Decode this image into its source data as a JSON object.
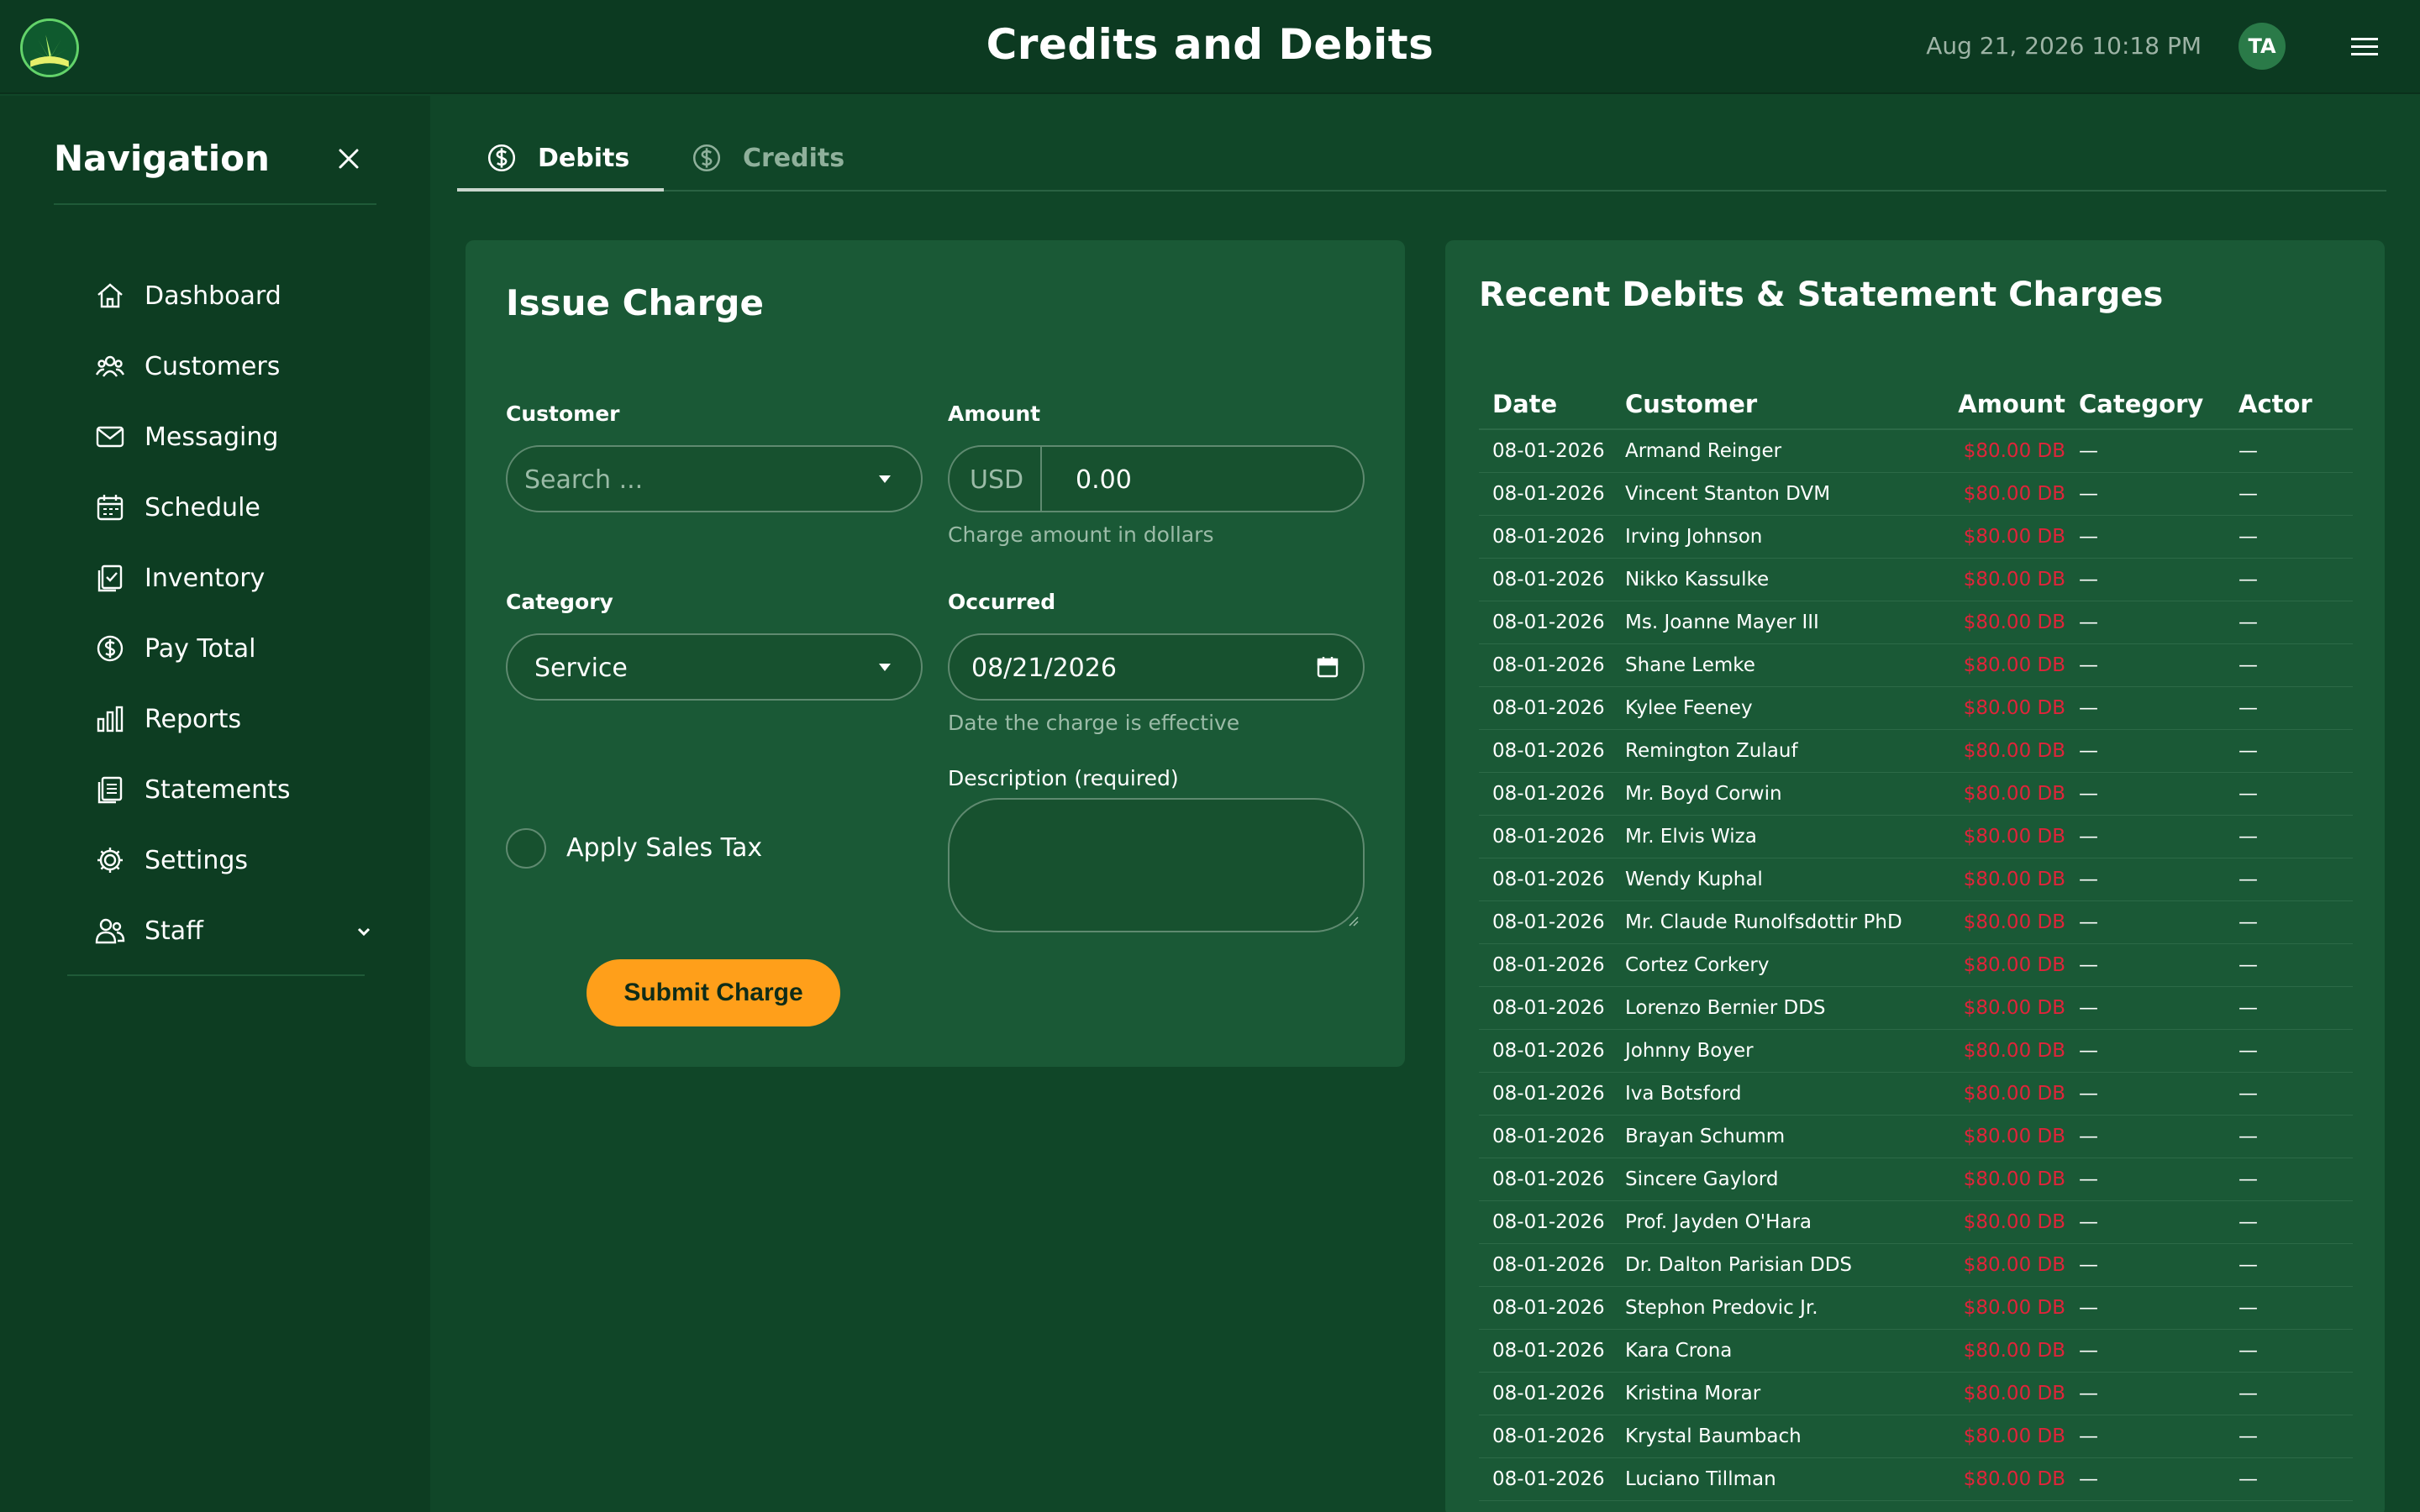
{
  "header": {
    "title": "Credits and Debits",
    "datetime": "Aug 21, 2026 10:18 PM",
    "avatar_initials": "TA"
  },
  "sidebar": {
    "title": "Navigation",
    "items": [
      {
        "label": "Dashboard",
        "icon": "home-icon"
      },
      {
        "label": "Customers",
        "icon": "users-icon"
      },
      {
        "label": "Messaging",
        "icon": "mail-icon"
      },
      {
        "label": "Schedule",
        "icon": "calendar-icon"
      },
      {
        "label": "Inventory",
        "icon": "clipboard-check-icon"
      },
      {
        "label": "Pay Total",
        "icon": "dollar-circle-icon"
      },
      {
        "label": "Reports",
        "icon": "bar-chart-icon"
      },
      {
        "label": "Statements",
        "icon": "document-list-icon"
      },
      {
        "label": "Settings",
        "icon": "gear-icon"
      },
      {
        "label": "Staff",
        "icon": "staff-icon"
      }
    ]
  },
  "tabs": [
    {
      "label": "Debits",
      "active": true
    },
    {
      "label": "Credits",
      "active": false
    }
  ],
  "issue_charge": {
    "title": "Issue Charge",
    "customer_label": "Customer",
    "customer_placeholder": "Search ...",
    "amount_label": "Amount",
    "currency": "USD",
    "amount_value": "0.00",
    "amount_helper": "Charge amount in dollars",
    "category_label": "Category",
    "category_value": "Service",
    "occurred_label": "Occurred",
    "occurred_value": "08/21/2026",
    "occurred_helper": "Date the charge is effective",
    "description_label": "Description (required)",
    "sales_tax_label": "Apply Sales Tax",
    "submit_label": "Submit Charge"
  },
  "recent": {
    "title": "Recent Debits & Statement Charges",
    "columns": [
      "Date",
      "Customer",
      "Amount",
      "Category",
      "Actor"
    ],
    "rows": [
      {
        "date": "08-01-2026",
        "customer": "Armand Reinger",
        "amount": "$80.00 DB",
        "category": "—",
        "actor": "—"
      },
      {
        "date": "08-01-2026",
        "customer": "Vincent Stanton DVM",
        "amount": "$80.00 DB",
        "category": "—",
        "actor": "—"
      },
      {
        "date": "08-01-2026",
        "customer": "Irving Johnson",
        "amount": "$80.00 DB",
        "category": "—",
        "actor": "—"
      },
      {
        "date": "08-01-2026",
        "customer": "Nikko Kassulke",
        "amount": "$80.00 DB",
        "category": "—",
        "actor": "—"
      },
      {
        "date": "08-01-2026",
        "customer": "Ms. Joanne Mayer III",
        "amount": "$80.00 DB",
        "category": "—",
        "actor": "—"
      },
      {
        "date": "08-01-2026",
        "customer": "Shane Lemke",
        "amount": "$80.00 DB",
        "category": "—",
        "actor": "—"
      },
      {
        "date": "08-01-2026",
        "customer": "Kylee Feeney",
        "amount": "$80.00 DB",
        "category": "—",
        "actor": "—"
      },
      {
        "date": "08-01-2026",
        "customer": "Remington Zulauf",
        "amount": "$80.00 DB",
        "category": "—",
        "actor": "—"
      },
      {
        "date": "08-01-2026",
        "customer": "Mr. Boyd Corwin",
        "amount": "$80.00 DB",
        "category": "—",
        "actor": "—"
      },
      {
        "date": "08-01-2026",
        "customer": "Mr. Elvis Wiza",
        "amount": "$80.00 DB",
        "category": "—",
        "actor": "—"
      },
      {
        "date": "08-01-2026",
        "customer": "Wendy Kuphal",
        "amount": "$80.00 DB",
        "category": "—",
        "actor": "—"
      },
      {
        "date": "08-01-2026",
        "customer": "Mr. Claude Runolfsdottir PhD",
        "amount": "$80.00 DB",
        "category": "—",
        "actor": "—"
      },
      {
        "date": "08-01-2026",
        "customer": "Cortez Corkery",
        "amount": "$80.00 DB",
        "category": "—",
        "actor": "—"
      },
      {
        "date": "08-01-2026",
        "customer": "Lorenzo Bernier DDS",
        "amount": "$80.00 DB",
        "category": "—",
        "actor": "—"
      },
      {
        "date": "08-01-2026",
        "customer": "Johnny Boyer",
        "amount": "$80.00 DB",
        "category": "—",
        "actor": "—"
      },
      {
        "date": "08-01-2026",
        "customer": "Iva Botsford",
        "amount": "$80.00 DB",
        "category": "—",
        "actor": "—"
      },
      {
        "date": "08-01-2026",
        "customer": "Brayan Schumm",
        "amount": "$80.00 DB",
        "category": "—",
        "actor": "—"
      },
      {
        "date": "08-01-2026",
        "customer": "Sincere Gaylord",
        "amount": "$80.00 DB",
        "category": "—",
        "actor": "—"
      },
      {
        "date": "08-01-2026",
        "customer": "Prof. Jayden O'Hara",
        "amount": "$80.00 DB",
        "category": "—",
        "actor": "—"
      },
      {
        "date": "08-01-2026",
        "customer": "Dr. Dalton Parisian DDS",
        "amount": "$80.00 DB",
        "category": "—",
        "actor": "—"
      },
      {
        "date": "08-01-2026",
        "customer": "Stephon Predovic Jr.",
        "amount": "$80.00 DB",
        "category": "—",
        "actor": "—"
      },
      {
        "date": "08-01-2026",
        "customer": "Kara Crona",
        "amount": "$80.00 DB",
        "category": "—",
        "actor": "—"
      },
      {
        "date": "08-01-2026",
        "customer": "Kristina Morar",
        "amount": "$80.00 DB",
        "category": "—",
        "actor": "—"
      },
      {
        "date": "08-01-2026",
        "customer": "Krystal Baumbach",
        "amount": "$80.00 DB",
        "category": "—",
        "actor": "—"
      },
      {
        "date": "08-01-2026",
        "customer": "Luciano Tillman",
        "amount": "$80.00 DB",
        "category": "—",
        "actor": "—"
      }
    ]
  },
  "colors": {
    "background": "#104628",
    "header": "#0c3a21",
    "card": "#1a5936",
    "accent": "#ff9f1a",
    "debit_amount": "#e0243a"
  }
}
